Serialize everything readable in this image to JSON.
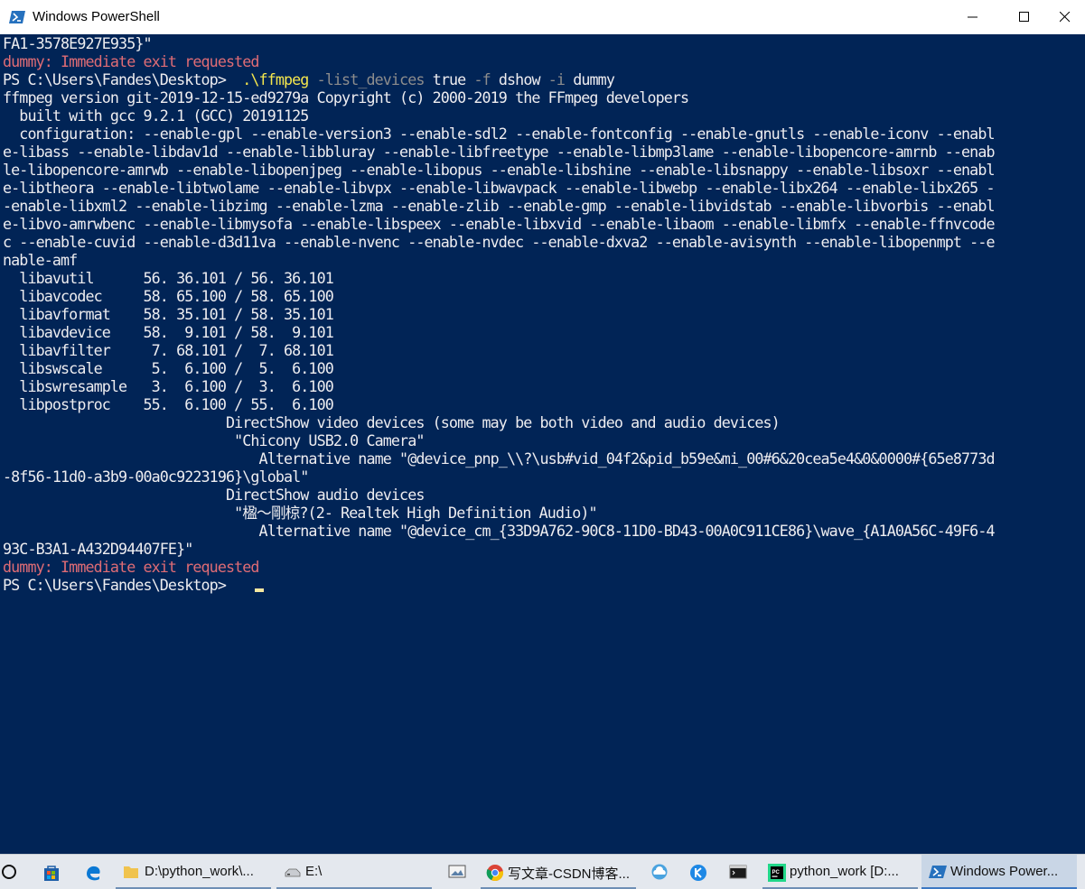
{
  "window": {
    "title": "Windows PowerShell",
    "app_icon": "powershell-icon",
    "controls": [
      "minimize-icon",
      "maximize-icon",
      "close-icon"
    ]
  },
  "console": {
    "background": "#012456",
    "prompt": "PS C:\\Users\\Fandes\\Desktop>",
    "lines": [
      "FA1-3578E927E935}\"",
      "dummy: Immediate exit requested",
      "PS C:\\Users\\Fandes\\Desktop>  .\\ffmpeg -list_devices true -f dshow -i dummy",
      "ffmpeg version git-2019-12-15-ed9279a Copyright (c) 2000-2019 the FFmpeg developers",
      "  built with gcc 9.2.1 (GCC) 20191125",
      "  configuration: --enable-gpl --enable-version3 --enable-sdl2 --enable-fontconfig --enable-gnutls --enable-iconv --enabl",
      "e-libass --enable-libdav1d --enable-libbluray --enable-libfreetype --enable-libmp3lame --enable-libopencore-amrnb --enab",
      "le-libopencore-amrwb --enable-libopenjpeg --enable-libopus --enable-libshine --enable-libsnappy --enable-libsoxr --enabl",
      "e-libtheora --enable-libtwolame --enable-libvpx --enable-libwavpack --enable-libwebp --enable-libx264 --enable-libx265 -",
      "-enable-libxml2 --enable-libzimg --enable-lzma --enable-zlib --enable-gmp --enable-libvidstab --enable-libvorbis --enabl",
      "e-libvo-amrwbenc --enable-libmysofa --enable-libspeex --enable-libxvid --enable-libaom --enable-libmfx --enable-ffnvcode",
      "c --enable-cuvid --enable-d3d11va --enable-nvenc --enable-nvdec --enable-dxva2 --enable-avisynth --enable-libopenmpt --e",
      "nable-amf",
      "  libavutil      56. 36.101 / 56. 36.101",
      "  libavcodec     58. 65.100 / 58. 65.100",
      "  libavformat    58. 35.101 / 58. 35.101",
      "  libavdevice    58.  9.101 / 58.  9.101",
      "  libavfilter     7. 68.101 /  7. 68.101",
      "  libswscale      5.  6.100 /  5.  6.100",
      "  libswresample   3.  6.100 /  3.  6.100",
      "  libpostproc    55.  6.100 / 55.  6.100",
      "                           DirectShow video devices (some may be both video and audio devices)",
      "                            \"Chicony USB2.0 Camera\"",
      "                               Alternative name \"@device_pnp_\\\\?\\usb#vid_04f2&pid_b59e&mi_00#6&20cea5e4&0&0000#{65e8773d",
      "-8f56-11d0-a3b9-00a0c9223196}\\global\"",
      "                           DirectShow audio devices",
      "                            \"楹～剛椋?(2- Realtek High Definition Audio)\"",
      "                               Alternative name \"@device_cm_{33D9A762-90C8-11D0-BD43-00A0C911CE86}\\wave_{A1A0A56C-49F6-4",
      "93C-B3A1-A432D94407FE}\"",
      "dummy: Immediate exit requested",
      "PS C:\\Users\\Fandes\\Desktop>"
    ],
    "command": {
      "exe": ".\\ffmpeg",
      "params": [
        {
          "flag": "-list_devices",
          "value": "true"
        },
        {
          "flag": "-f",
          "value": "dshow"
        },
        {
          "flag": "-i",
          "value": "dummy"
        }
      ]
    },
    "colors": {
      "text": "#eeedf0",
      "error": "#e06c75",
      "command": "#f5e74d",
      "parameter": "#8d8d8d"
    }
  },
  "taskbar": {
    "items": [
      {
        "icon": "cortana-circle-icon"
      },
      {
        "icon": "store-icon"
      },
      {
        "icon": "edge-icon"
      },
      {
        "icon": "folder-icon",
        "label": "D:\\python_work\\..."
      },
      {
        "icon": "drive-icon",
        "label": "E:\\"
      },
      {
        "icon": "image-viewer-icon"
      },
      {
        "icon": "chrome-icon",
        "label": "写文章-CSDN博客..."
      },
      {
        "icon": "cloud-icon"
      },
      {
        "icon": "k-app-icon"
      },
      {
        "icon": "terminal-icon"
      },
      {
        "icon": "pycharm-icon",
        "label": "python_work [D:..."
      },
      {
        "icon": "powershell-icon",
        "label": "Windows Power..."
      }
    ]
  }
}
